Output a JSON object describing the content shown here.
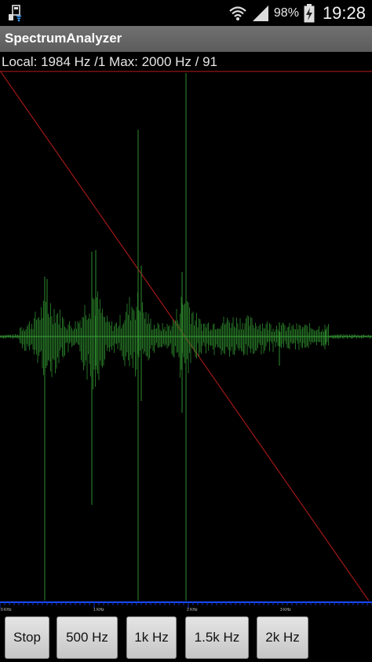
{
  "status_bar": {
    "battery_percent": "98%",
    "time": "19:28",
    "icons": [
      "usb-debug-icon",
      "wifi-icon",
      "signal-icon",
      "battery-charging-icon"
    ]
  },
  "app": {
    "title": "SpectrumAnalyzer"
  },
  "info": {
    "text": "Local: 1984 Hz /1 Max: 2000 Hz / 91"
  },
  "spectrum": {
    "axis_labels": [
      "0 KHz",
      "1 KHz",
      "2 KHz",
      "3 KHz"
    ],
    "colors": {
      "waveform": "#2e8b2e",
      "diagonal": "#a01818",
      "scale_bar": "#1030c8",
      "background": "#000000"
    }
  },
  "buttons": [
    {
      "label": "Stop"
    },
    {
      "label": "500 Hz"
    },
    {
      "label": "1k Hz"
    },
    {
      "label": "1.5k Hz"
    },
    {
      "label": "2k Hz"
    }
  ]
}
